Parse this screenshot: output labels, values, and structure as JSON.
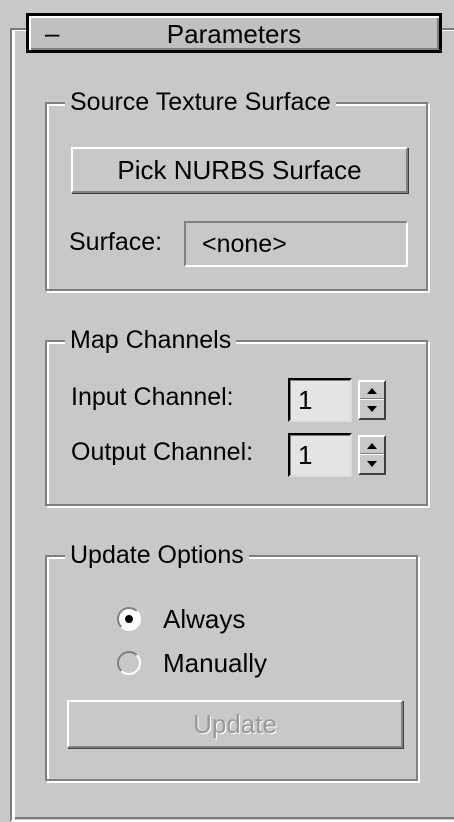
{
  "rollout": {
    "collapse_symbol": "–",
    "title": "Parameters"
  },
  "source_group": {
    "title": "Source Texture Surface",
    "pick_button": "Pick NURBS Surface",
    "surface_label": "Surface:",
    "surface_value": "<none>"
  },
  "map_group": {
    "title": "Map Channels",
    "input_label": "Input Channel:",
    "input_value": "1",
    "output_label": "Output Channel:",
    "output_value": "1"
  },
  "update_group": {
    "title": "Update Options",
    "options": [
      {
        "label": "Always",
        "selected": true
      },
      {
        "label": "Manually",
        "selected": false
      }
    ],
    "update_button": "Update",
    "update_button_enabled": false
  },
  "icons": {
    "spinner_up": "triangle-up-icon",
    "spinner_down": "triangle-down-icon"
  },
  "colors": {
    "panel_bg": "#c8c8c8",
    "disabled_text": "#9a9a9a"
  }
}
